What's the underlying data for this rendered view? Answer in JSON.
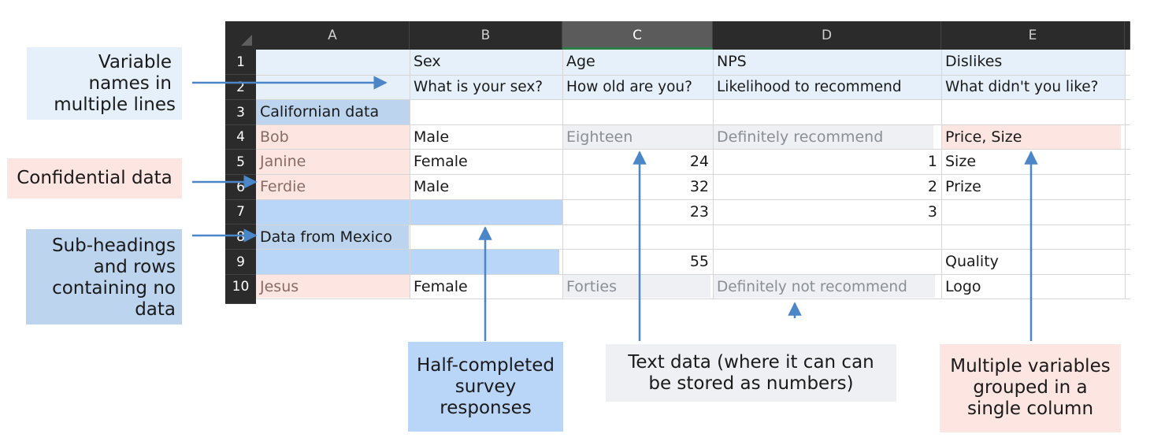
{
  "columns": [
    "A",
    "B",
    "C",
    "D",
    "E"
  ],
  "rows": [
    "1",
    "2",
    "3",
    "4",
    "5",
    "6",
    "7",
    "8",
    "9",
    "10"
  ],
  "cells": {
    "b1": "Sex",
    "c1": "Age",
    "d1": "NPS",
    "e1": "Dislikes",
    "b2": "What is your sex?",
    "c2": "How old are you?",
    "d2": "Likelihood to recommend",
    "e2": "What didn't you like?",
    "a3": "Californian data",
    "a4": "Bob",
    "b4": "Male",
    "c4": "Eighteen",
    "d4": "Definitely recommend",
    "e4": "Price, Size",
    "a5": "Janine",
    "b5": "Female",
    "c5": "24",
    "d5": "1",
    "e5": "Size",
    "a6": "Ferdie",
    "b6": "Male",
    "c6": "32",
    "d6": "2",
    "e6": "Prize",
    "c7": "23",
    "d7": "3",
    "a8": "Data from Mexico",
    "c9": "55",
    "e9": "Quality",
    "a10": "Jesus",
    "b10": "Female",
    "c10": "Forties",
    "d10": "Definitely not recommend",
    "e10": "Logo"
  },
  "callouts": {
    "variable_names": [
      "Variable",
      "names in",
      "multiple lines"
    ],
    "confidential": "Confidential data",
    "subheadings": [
      "Sub-headings",
      "and rows",
      "containing no",
      "data"
    ],
    "half_completed": [
      "Half-completed",
      "survey",
      "responses"
    ],
    "text_data": [
      "Text data (where it can can",
      "be stored as numbers)"
    ],
    "multiple_variables": [
      "Multiple variables",
      "grouped in a",
      "single column"
    ]
  },
  "colors": {
    "header_bg": "#2b2b2b",
    "selected_header_bg": "#5b5b5b",
    "selected_header_underline": "#2e7d46",
    "light_blue": "#e6f0fb",
    "pink": "#fde6e2",
    "gray": "#eef0f3",
    "subheading_blue": "#bcd4ee",
    "empty_row_blue": "#b9d6f9",
    "arrow": "#4a86c8"
  }
}
